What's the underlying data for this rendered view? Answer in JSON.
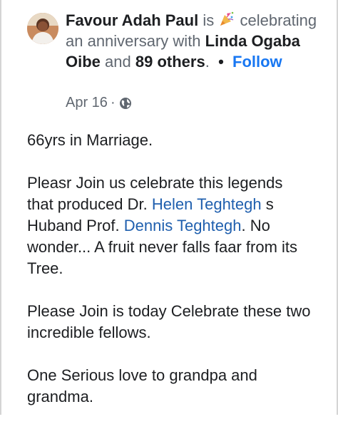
{
  "post": {
    "author": "Favour Adah Paul",
    "activity_prefix": "is",
    "activity_icon": "party-popper-icon",
    "activity_text": "celebrating an anniversary with",
    "tagged_person": "Linda Ogaba Oibe",
    "and_word": "and",
    "others": "89 others",
    "others_suffix": ".",
    "separator": "•",
    "follow_label": "Follow",
    "date": "Apr 16",
    "dot": "·",
    "audience_icon": "globe-icon",
    "paragraphs": {
      "p1": "66yrs in Marriage.",
      "p2_a": "Pleasr Join us celebrate this legends that produced Dr.",
      "p2_link1": "Helen Teghtegh",
      "p2_b": "s Huband Prof.",
      "p2_link2": "Dennis Teghtegh",
      "p2_c": ". No wonder... A fruit never falls faar from its Tree.",
      "p3": "Please Join is today Celebrate these two incredible fellows.",
      "p4": "One Serious love to grandpa and grandma."
    }
  },
  "colors": {
    "link": "#1f5fae",
    "follow": "#1877f2",
    "secondary_text": "#606770",
    "primary_text": "#1c1e21"
  }
}
